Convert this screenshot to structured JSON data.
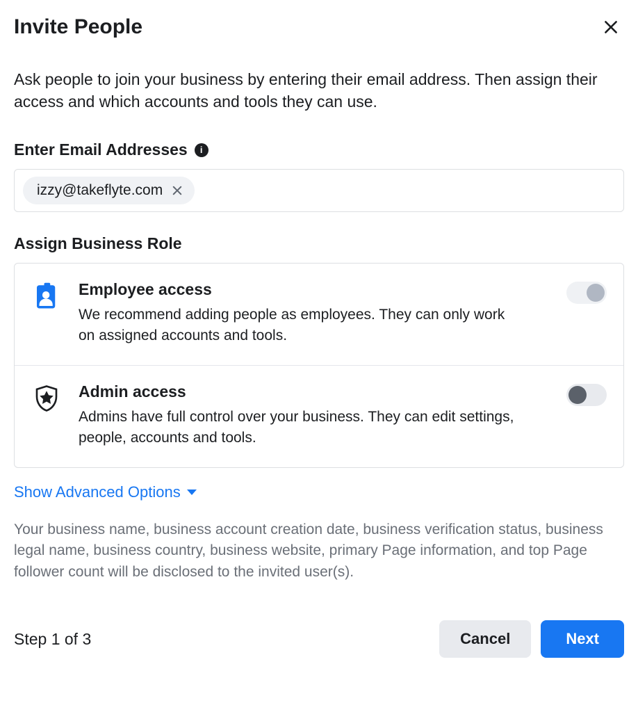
{
  "header": {
    "title": "Invite People"
  },
  "intro": "Ask people to join your business by entering their email address. Then assign their access and which accounts and tools they can use.",
  "email_section": {
    "label": "Enter Email Addresses",
    "chips": [
      {
        "email": "izzy@takeflyte.com"
      }
    ]
  },
  "role_section": {
    "label": "Assign Business Role",
    "roles": [
      {
        "key": "employee",
        "title": "Employee access",
        "description": "We recommend adding people as employees. They can only work on assigned accounts and tools.",
        "icon": "badge-icon",
        "toggle_state": "off-light"
      },
      {
        "key": "admin",
        "title": "Admin access",
        "description": "Admins have full control over your business. They can edit settings, people, accounts and tools.",
        "icon": "shield-star-icon",
        "toggle_state": "off-dark"
      }
    ]
  },
  "advanced_link": "Show Advanced Options",
  "disclosure": "Your business name, business account creation date, business verification status, business legal name, business country, business website, primary Page information, and top Page follower count will be disclosed to the invited user(s).",
  "footer": {
    "step": "Step 1 of 3",
    "cancel": "Cancel",
    "next": "Next"
  },
  "colors": {
    "accent": "#1877f2"
  }
}
